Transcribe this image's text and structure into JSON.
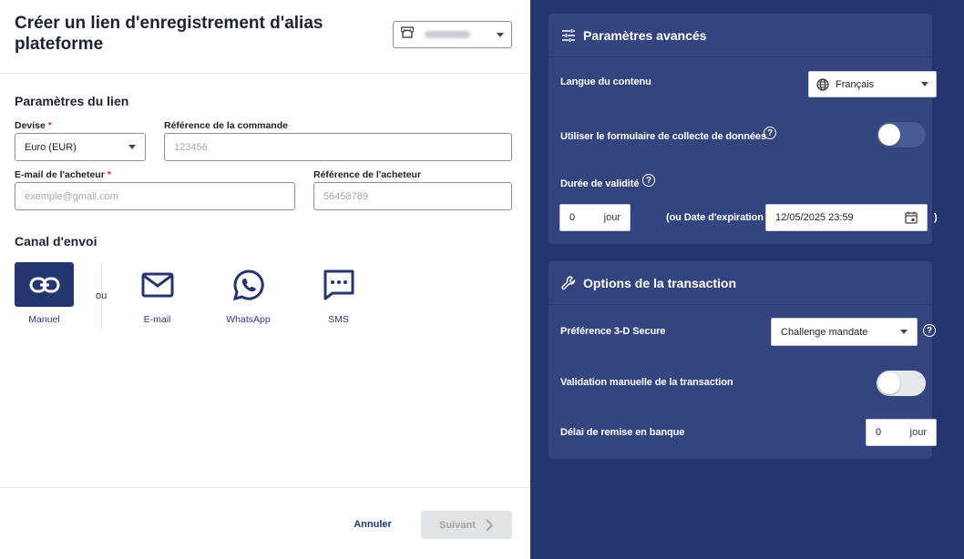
{
  "header": {
    "title": "Créer un lien d'enregistrement d'alias plateforme"
  },
  "link_params": {
    "section_title": "Paramètres du lien",
    "currency_label": "Devise",
    "currency_value": "Euro (EUR)",
    "order_ref_label": "Référence de la commande",
    "order_ref_placeholder": "123456",
    "buyer_email_label": "E-mail de l'acheteur",
    "buyer_email_placeholder": "exemple@gmail.com",
    "buyer_ref_label": "Référence de l'acheteur",
    "buyer_ref_placeholder": "56458789",
    "required_mark": "*"
  },
  "channels": {
    "section_title": "Canal d'envoi",
    "or_label": "ou",
    "items": [
      {
        "label": "Manuel",
        "icon": "link-icon",
        "active": true
      },
      {
        "label": "E-mail",
        "icon": "mail-icon",
        "active": false
      },
      {
        "label": "WhatsApp",
        "icon": "whatsapp-icon",
        "active": false
      },
      {
        "label": "SMS",
        "icon": "sms-icon",
        "active": false
      }
    ]
  },
  "footer": {
    "cancel_label": "Annuler",
    "next_label": "Suivant"
  },
  "advanced": {
    "title": "Paramètres avancés",
    "content_lang_label": "Langue du contenu",
    "content_lang_value": "Français",
    "data_form_label": "Utiliser le formulaire de collecte de données",
    "data_form_enabled": false,
    "validity_label": "Durée de validité",
    "validity_value": "0",
    "validity_unit": "jour",
    "expiry_prefix": "(ou Date d'expiration",
    "expiry_value": "12/05/2025 23:59",
    "expiry_suffix": ")"
  },
  "transaction": {
    "title": "Options de la transaction",
    "secure_label": "Préférence 3-D Secure",
    "secure_value": "Challenge mandate",
    "manual_validation_label": "Validation manuelle de la transaction",
    "manual_validation_enabled": false,
    "bank_delay_label": "Délai de remise en banque",
    "bank_delay_value": "0",
    "bank_delay_unit": "jour"
  },
  "colors": {
    "accent": "#253570",
    "card": "#34447f",
    "toggle_off": "#4a5a93",
    "required": "#d32f2f"
  }
}
